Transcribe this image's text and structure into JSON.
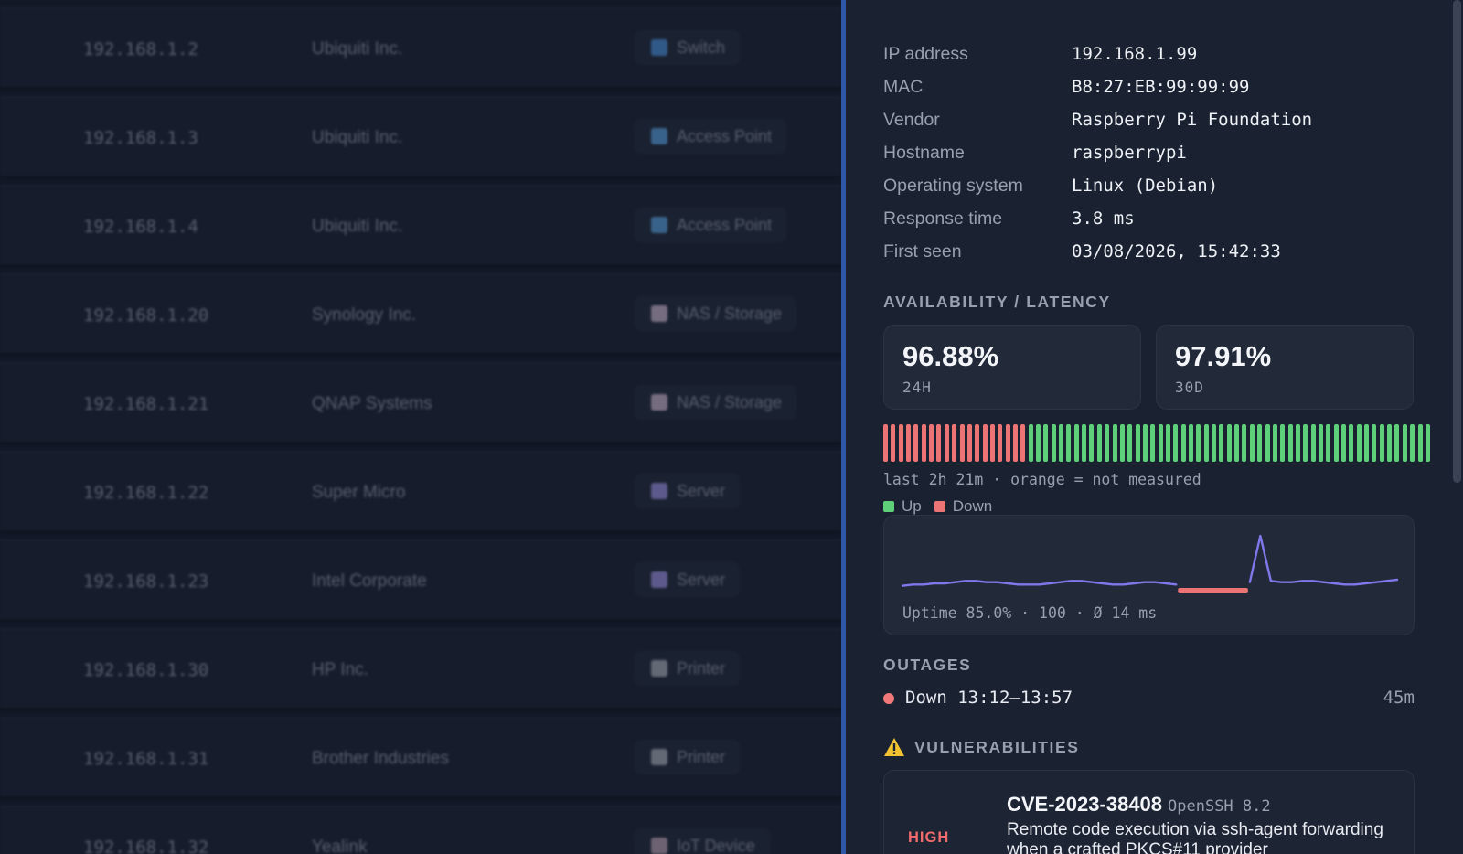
{
  "device_list": [
    {
      "ip": "192.168.1.2",
      "vendor": "Ubiquiti Inc.",
      "type": "Switch",
      "type_icon": "switch-icon"
    },
    {
      "ip": "192.168.1.3",
      "vendor": "Ubiquiti Inc.",
      "type": "Access Point",
      "type_icon": "access-point-icon"
    },
    {
      "ip": "192.168.1.4",
      "vendor": "Ubiquiti Inc.",
      "type": "Access Point",
      "type_icon": "access-point-icon"
    },
    {
      "ip": "192.168.1.20",
      "vendor": "Synology Inc.",
      "type": "NAS / Storage",
      "type_icon": "nas-icon"
    },
    {
      "ip": "192.168.1.21",
      "vendor": "QNAP Systems",
      "type": "NAS / Storage",
      "type_icon": "nas-icon"
    },
    {
      "ip": "192.168.1.22",
      "vendor": "Super Micro",
      "type": "Server",
      "type_icon": "server-icon"
    },
    {
      "ip": "192.168.1.23",
      "vendor": "Intel Corporate",
      "type": "Server",
      "type_icon": "server-icon"
    },
    {
      "ip": "192.168.1.30",
      "vendor": "HP Inc.",
      "type": "Printer",
      "type_icon": "printer-icon"
    },
    {
      "ip": "192.168.1.31",
      "vendor": "Brother Industries",
      "type": "Printer",
      "type_icon": "printer-icon"
    },
    {
      "ip": "192.168.1.32",
      "vendor": "Yealink",
      "type": "IoT Device",
      "type_icon": "iot-icon"
    }
  ],
  "details": {
    "fields": [
      {
        "key": "IP address",
        "value": "192.168.1.99"
      },
      {
        "key": "MAC",
        "value": "B8:27:EB:99:99:99"
      },
      {
        "key": "Vendor",
        "value": "Raspberry Pi Foundation"
      },
      {
        "key": "Hostname",
        "value": "raspberrypi"
      },
      {
        "key": "Operating system",
        "value": "Linux (Debian)"
      },
      {
        "key": "Response time",
        "value": "3.8 ms"
      },
      {
        "key": "First seen",
        "value": "03/08/2026, 15:42:33"
      }
    ]
  },
  "availability": {
    "title": "AVAILABILITY / LATENCY",
    "uptime_24h": "96.88%",
    "label_24h": "24H",
    "uptime_30d": "97.91%",
    "label_30d": "30D",
    "heatmap_note": "last 2h 21m · orange = not measured",
    "heatmap_down_count": 19,
    "heatmap_up_count": 53,
    "legend_up": "Up",
    "legend_down": "Down",
    "latency_caption": "Uptime 85.0% · 100 · Ø 14 ms"
  },
  "outages": {
    "title": "OUTAGES",
    "items": [
      {
        "label": "Down 13:12–13:57",
        "duration": "45m"
      }
    ]
  },
  "vulnerabilities": {
    "title": "VULNERABILITIES",
    "items": [
      {
        "severity": "HIGH",
        "cve": "CVE-2023-38408",
        "package": "OpenSSH 8.2",
        "description": "Remote code execution via ssh-agent forwarding when a crafted PKCS#11 provider"
      }
    ]
  },
  "colors": {
    "up": "#5fd07a",
    "down": "#ec7474",
    "latency_line": "#7f78ea",
    "accent_divider": "#2e57a8"
  },
  "chart_data": {
    "type": "line",
    "series": [
      {
        "values": [
          0.4,
          0.5,
          0.5,
          0.6,
          0.6,
          0.7,
          0.8,
          0.8,
          0.7,
          0.7,
          0.6,
          0.5,
          0.5,
          0.5,
          0.6,
          0.7,
          0.8,
          0.8,
          0.7,
          0.6,
          0.5,
          0.5,
          0.6,
          0.7,
          0.7,
          0.6,
          0.5,
          0.4,
          0.5,
          0.6,
          0.6,
          0.5,
          0.6,
          0.7,
          4.5,
          0.8,
          0.7,
          0.7,
          0.8,
          0.8,
          0.7,
          0.6,
          0.5,
          0.5,
          0.6,
          0.7,
          0.8,
          0.9
        ]
      }
    ],
    "down_range": [
      26,
      33
    ],
    "grid": false
  }
}
